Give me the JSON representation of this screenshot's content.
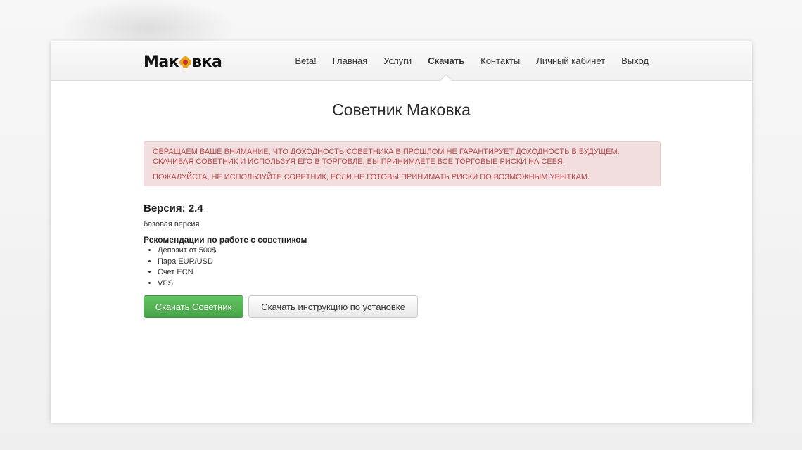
{
  "brand": {
    "logo_left": "Мак",
    "logo_right": "вка",
    "flower_colors": {
      "petal": "#e8a21b",
      "core": "#c8321e"
    }
  },
  "nav": {
    "items": [
      {
        "label": "Beta!"
      },
      {
        "label": "Главная"
      },
      {
        "label": "Услуги"
      },
      {
        "label": "Скачать",
        "active": true
      },
      {
        "label": "Контакты"
      },
      {
        "label": "Личный кабинет"
      },
      {
        "label": "Выход"
      }
    ]
  },
  "page": {
    "title": "Советник Маковка"
  },
  "alert": {
    "line1": "ОБРАЩАЕМ ВАШЕ ВНИМАНИЕ, ЧТО ДОХОДНОСТЬ СОВЕТНИКА В ПРОШЛОМ НЕ ГАРАНТИРУЕТ ДОХОДНОСТЬ В БУДУЩЕМ. СКАЧИВАЯ СОВЕТНИК И ИСПОЛЬЗУЯ ЕГО В ТОРГОВЛЕ, ВЫ ПРИНИМАЕТЕ ВСЕ ТОРГОВЫЕ РИСКИ НА СЕБЯ.",
    "line2": "ПОЖАЛУЙСТА, НЕ ИСПОЛЬЗУЙТЕ СОВЕТНИК, ЕСЛИ НЕ ГОТОВЫ ПРИНИМАТЬ РИСКИ ПО ВОЗМОЖНЫМ УБЫТКАМ.",
    "colors": {
      "text": "#b94a48",
      "background": "#f2dede"
    }
  },
  "content": {
    "version": "Версия: 2.4",
    "subtitle": "базовая версия",
    "recommendations_title": "Рекомендации по работе с советником",
    "recommendations": [
      "Депозит от 500$",
      "Пара EUR/USD",
      "Счет ECN",
      "VPS"
    ]
  },
  "buttons": {
    "download_advisor": "Скачать Советник",
    "download_instructions": "Скачать инструкцию по установке",
    "primary_color": "#4aa44a"
  }
}
